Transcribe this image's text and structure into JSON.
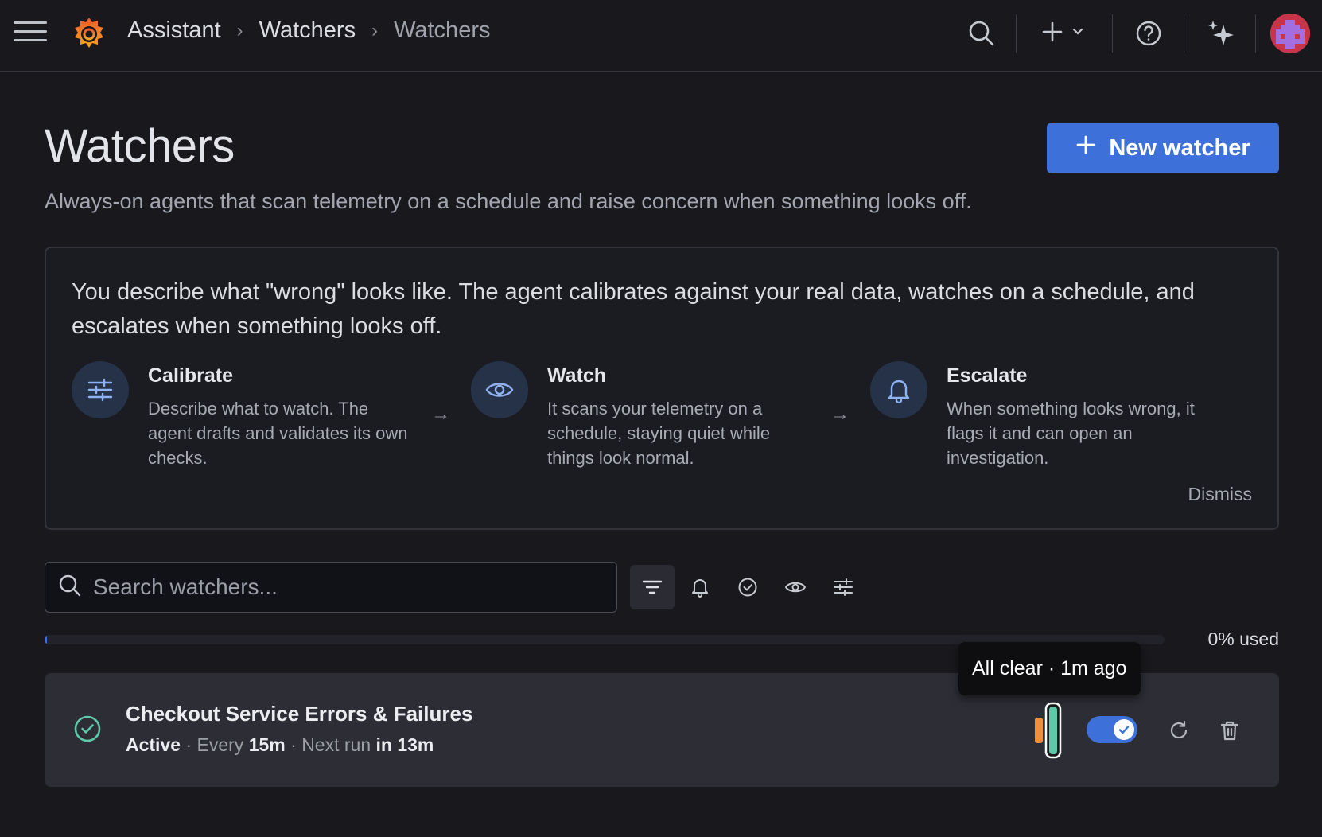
{
  "topbar": {
    "breadcrumbs": [
      "Assistant",
      "Watchers",
      "Watchers"
    ],
    "icons": [
      "menu-icon",
      "grafana-logo",
      "search-icon",
      "plus-icon",
      "chevron-down-icon",
      "help-icon",
      "sparkle-icon",
      "avatar"
    ]
  },
  "header": {
    "title": "Watchers",
    "subtitle": "Always-on agents that scan telemetry on a schedule and raise concern when something looks off.",
    "new_button_label": "New watcher"
  },
  "intro": {
    "text": "You describe what \"wrong\" looks like. The agent calibrates against your real data, watches on a schedule, and escalates when something looks off.",
    "steps": [
      {
        "title": "Calibrate",
        "description": "Describe what to watch. The agent drafts and validates its own checks.",
        "icon": "sliders-icon"
      },
      {
        "title": "Watch",
        "description": "It scans your telemetry on a schedule, staying quiet while things look normal.",
        "icon": "eye-icon"
      },
      {
        "title": "Escalate",
        "description": "When something looks wrong, it flags it and can open an investigation.",
        "icon": "bell-icon"
      }
    ],
    "dismiss_label": "Dismiss"
  },
  "toolbar": {
    "search_placeholder": "Search watchers...",
    "filters": [
      "filter-all-icon",
      "bell-icon",
      "check-circle-icon",
      "eye-icon",
      "sliders-icon"
    ]
  },
  "usage": {
    "percent": 0,
    "label": "0% used"
  },
  "watchers": [
    {
      "name": "Checkout Service Errors & Failures",
      "status": "Active",
      "every_prefix": "Every",
      "interval": "15m",
      "next_run_prefix": "Next run",
      "next_run": "in 13m",
      "enabled": true,
      "tooltip": "All clear · 1m ago"
    }
  ],
  "colors": {
    "accent": "#3d71d9",
    "success": "#5ec9a9",
    "warning": "#f0903a",
    "background": "#19191d",
    "row_background": "#2c2d35"
  }
}
